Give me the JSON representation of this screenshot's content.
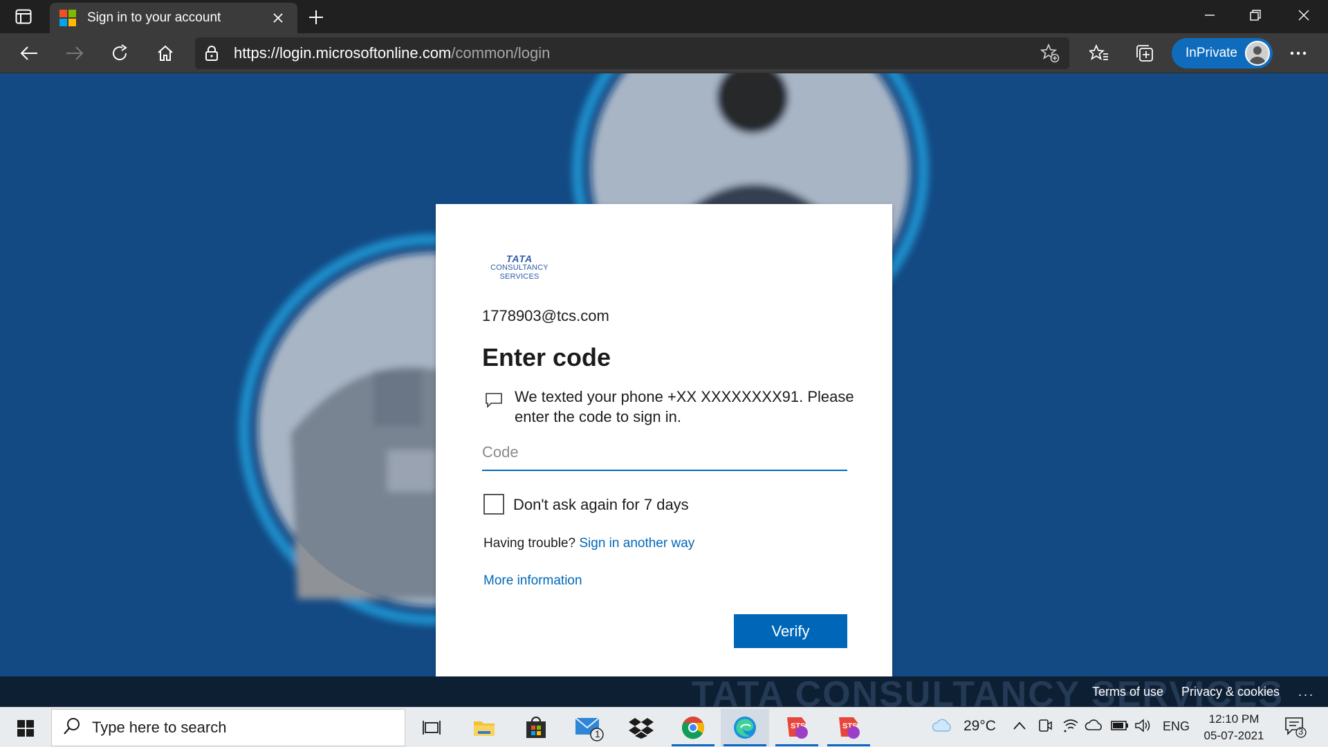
{
  "browser": {
    "tab_title": "Sign in to your account",
    "url_host": "https://login.microsoftonline.com",
    "url_path": "/common/login",
    "inprivate_label": "InPrivate"
  },
  "signin": {
    "logo": {
      "line1": "TATA",
      "line2": "CONSULTANCY",
      "line3": "SERVICES"
    },
    "identity": "1778903@tcs.com",
    "heading": "Enter code",
    "message": "We texted your phone +XX XXXXXXXX91. Please enter the code to sign in.",
    "code_placeholder": "Code",
    "code_value": "",
    "remember_label": "Don't ask again for 7 days",
    "remember_checked": false,
    "trouble_text": "Having trouble?",
    "trouble_link": "Sign in another way",
    "more_info": "More information",
    "verify_label": "Verify"
  },
  "page_footer": {
    "watermark": "TATA CONSULTANCY SERVICES",
    "terms": "Terms of use",
    "privacy": "Privacy & cookies",
    "more": "..."
  },
  "taskbar": {
    "search_placeholder": "Type here to search",
    "mail_badge": "1",
    "weather_temp": "29°C",
    "language": "ENG",
    "time": "12:10 PM",
    "date": "05-07-2021",
    "notification_count": "3"
  },
  "colors": {
    "accent": "#0067b8",
    "page_bg": "#144a84",
    "titlebar": "#202020",
    "toolbar": "#3b3b3b",
    "inprivate": "#0f6cbd"
  }
}
